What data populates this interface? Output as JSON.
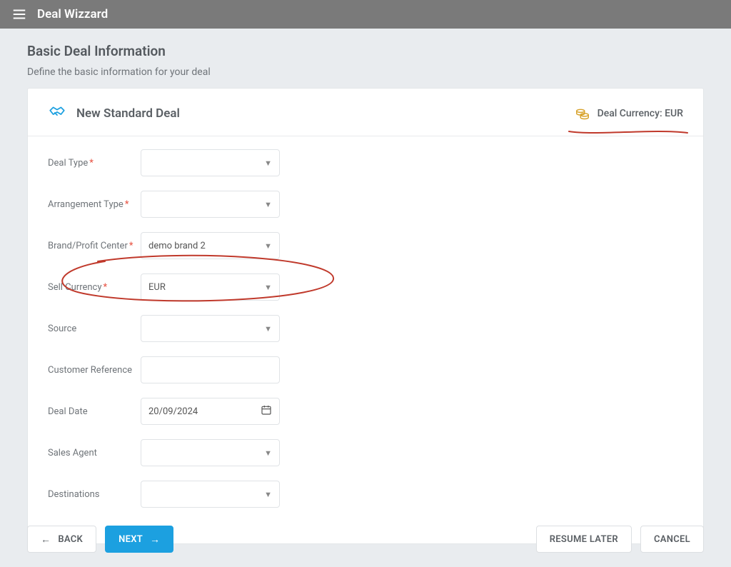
{
  "topbar": {
    "title": "Deal Wizzard"
  },
  "page": {
    "heading": "Basic Deal Information",
    "subheading": "Define the basic information for your deal"
  },
  "card": {
    "title": "New Standard Deal",
    "currency_label": "Deal Currency: EUR"
  },
  "form": {
    "deal_type": {
      "label": "Deal Type",
      "required": true,
      "value": ""
    },
    "arrangement_type": {
      "label": "Arrangement Type",
      "required": true,
      "value": ""
    },
    "brand": {
      "label": "Brand/Profit Center",
      "required": true,
      "value": "demo brand 2"
    },
    "sell_currency": {
      "label": "Sell Currency",
      "required": true,
      "value": "EUR"
    },
    "source": {
      "label": "Source",
      "required": false,
      "value": ""
    },
    "customer_reference": {
      "label": "Customer Reference",
      "required": false,
      "value": ""
    },
    "deal_date": {
      "label": "Deal Date",
      "required": false,
      "value": "20/09/2024"
    },
    "sales_agent": {
      "label": "Sales Agent",
      "required": false,
      "value": ""
    },
    "destinations": {
      "label": "Destinations",
      "required": false,
      "value": ""
    }
  },
  "buttons": {
    "back": "BACK",
    "next": "NEXT",
    "resume": "RESUME LATER",
    "cancel": "CANCEL"
  }
}
